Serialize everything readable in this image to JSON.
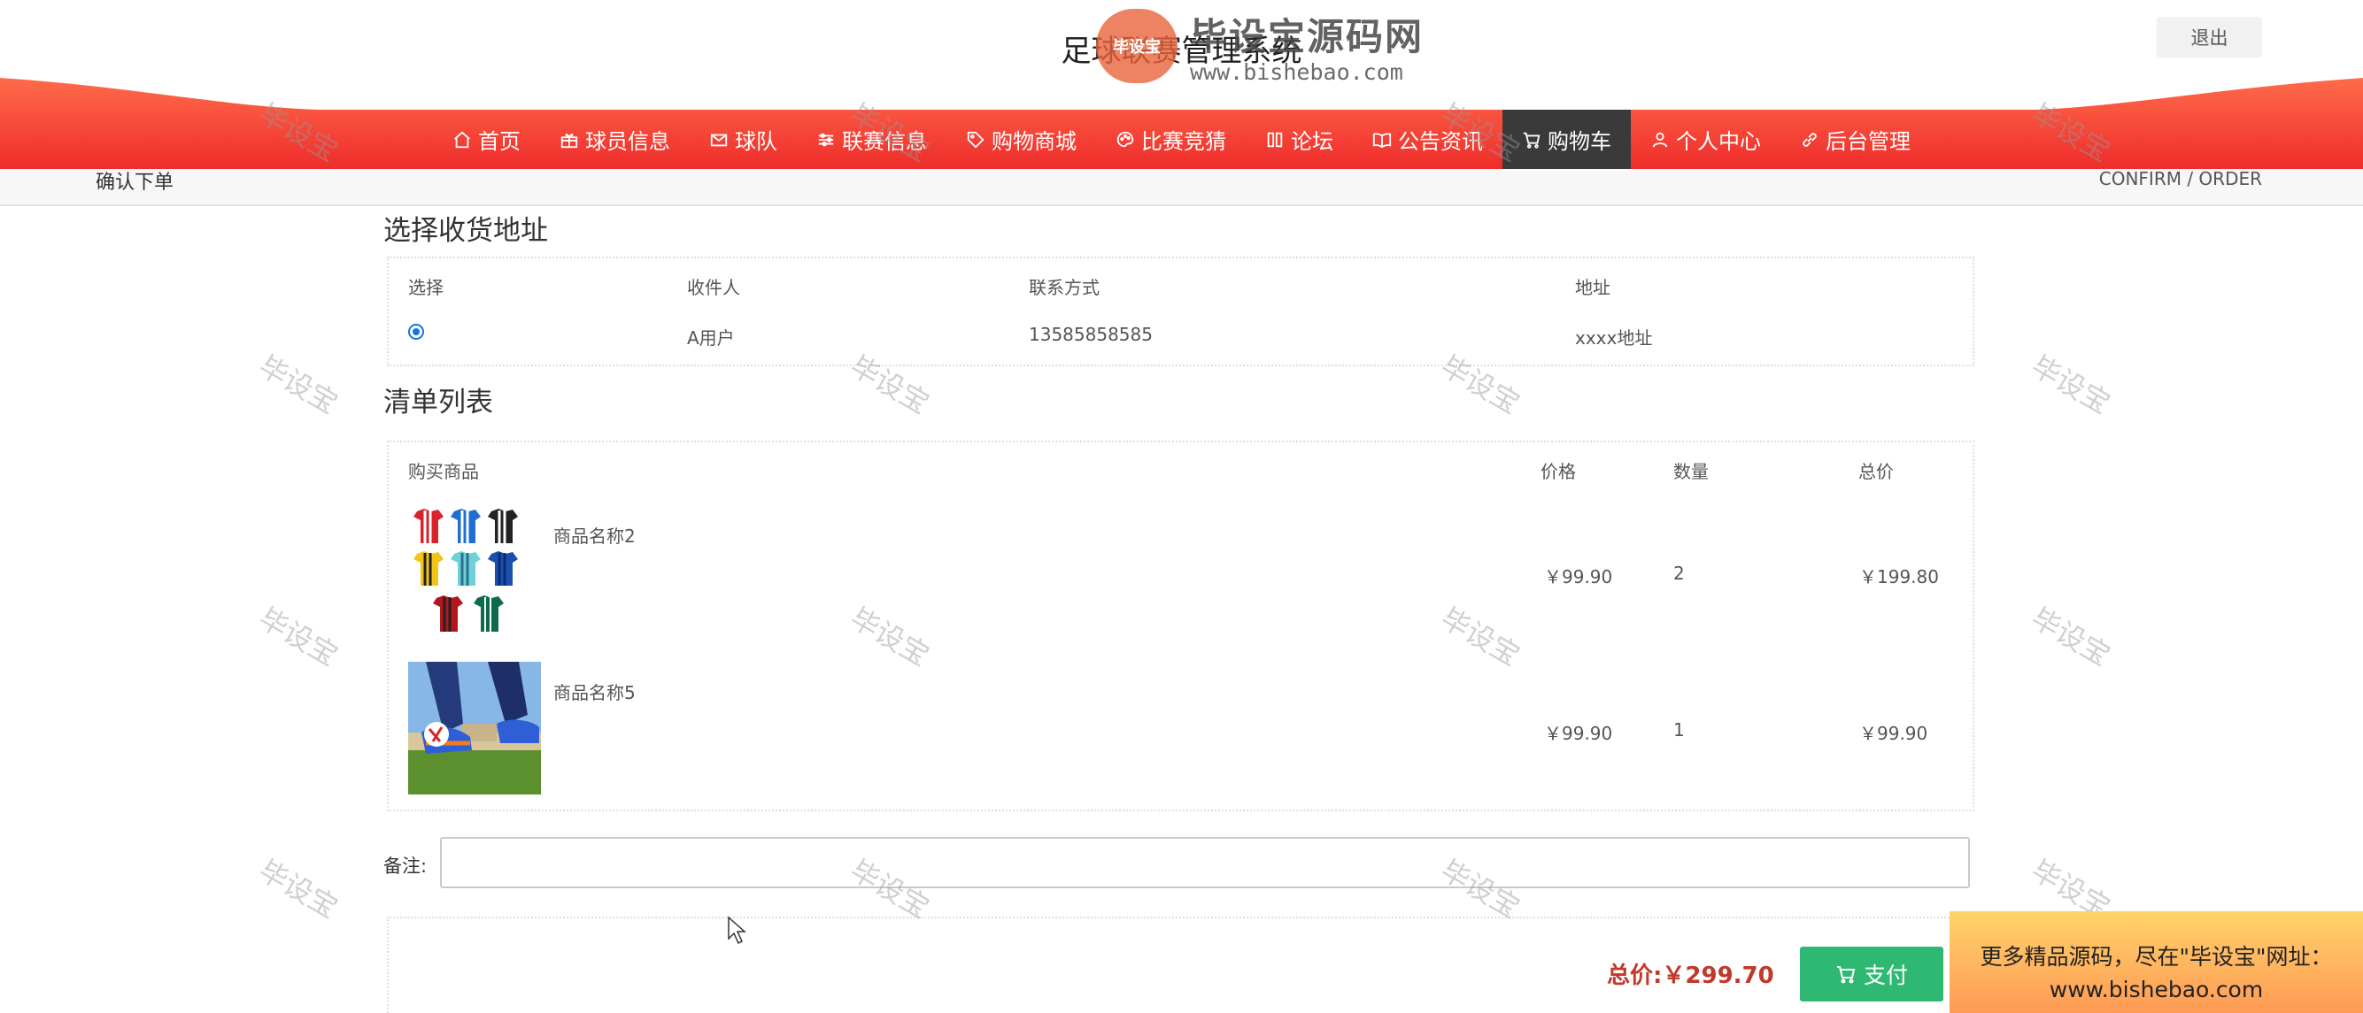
{
  "header": {
    "title": "足球联赛管理系统",
    "logout": "退出",
    "brand": {
      "logo_text": "毕设宝",
      "name": "毕设宝源码网",
      "url": "www.bishebao.com"
    }
  },
  "nav": {
    "items": [
      {
        "label": "首页",
        "icon": "home-icon"
      },
      {
        "label": "球员信息",
        "icon": "gift-icon"
      },
      {
        "label": "球队",
        "icon": "mail-icon"
      },
      {
        "label": "联赛信息",
        "icon": "sliders-icon"
      },
      {
        "label": "购物商城",
        "icon": "tag-icon"
      },
      {
        "label": "比赛竞猜",
        "icon": "palette-icon"
      },
      {
        "label": "论坛",
        "icon": "columns-icon"
      },
      {
        "label": "公告资讯",
        "icon": "book-icon"
      },
      {
        "label": "购物车",
        "icon": "cart-icon",
        "active": true
      },
      {
        "label": "个人中心",
        "icon": "user-icon"
      },
      {
        "label": "后台管理",
        "icon": "link-icon"
      }
    ],
    "active_color": "#3a3a3a",
    "band_color": "#f2493c"
  },
  "breadcrumb": {
    "left": "确认下单",
    "right": "CONFIRM / ORDER"
  },
  "address": {
    "title": "选择收货地址",
    "headers": [
      "选择",
      "收件人",
      "联系方式",
      "地址"
    ],
    "rows": [
      {
        "selected": true,
        "name": "A用户",
        "phone": "13585858585",
        "address": "xxxx地址"
      }
    ]
  },
  "order_list": {
    "title": "清单列表",
    "headers": [
      "购买商品",
      "价格",
      "数量",
      "总价"
    ],
    "items": [
      {
        "name": "商品名称2",
        "price": "￥99.90",
        "qty": "2",
        "total": "￥199.80",
        "image": "jerseys-image"
      },
      {
        "name": "商品名称5",
        "price": "￥99.90",
        "qty": "1",
        "total": "￥99.90",
        "image": "football-boots-image"
      }
    ]
  },
  "remark": {
    "label": "备注:",
    "value": ""
  },
  "footer": {
    "total_label": "总价:",
    "total_value": "￥299.70",
    "pay_label": "支付"
  },
  "watermark": "毕设宝",
  "promo": {
    "line1": "更多精品源码，尽在\"毕设宝\"网址：",
    "line2": "www.bishebao.com"
  },
  "colors": {
    "pay_button": "#2eb872",
    "total_text": "#c0392b",
    "radio": "#1a73e8"
  }
}
